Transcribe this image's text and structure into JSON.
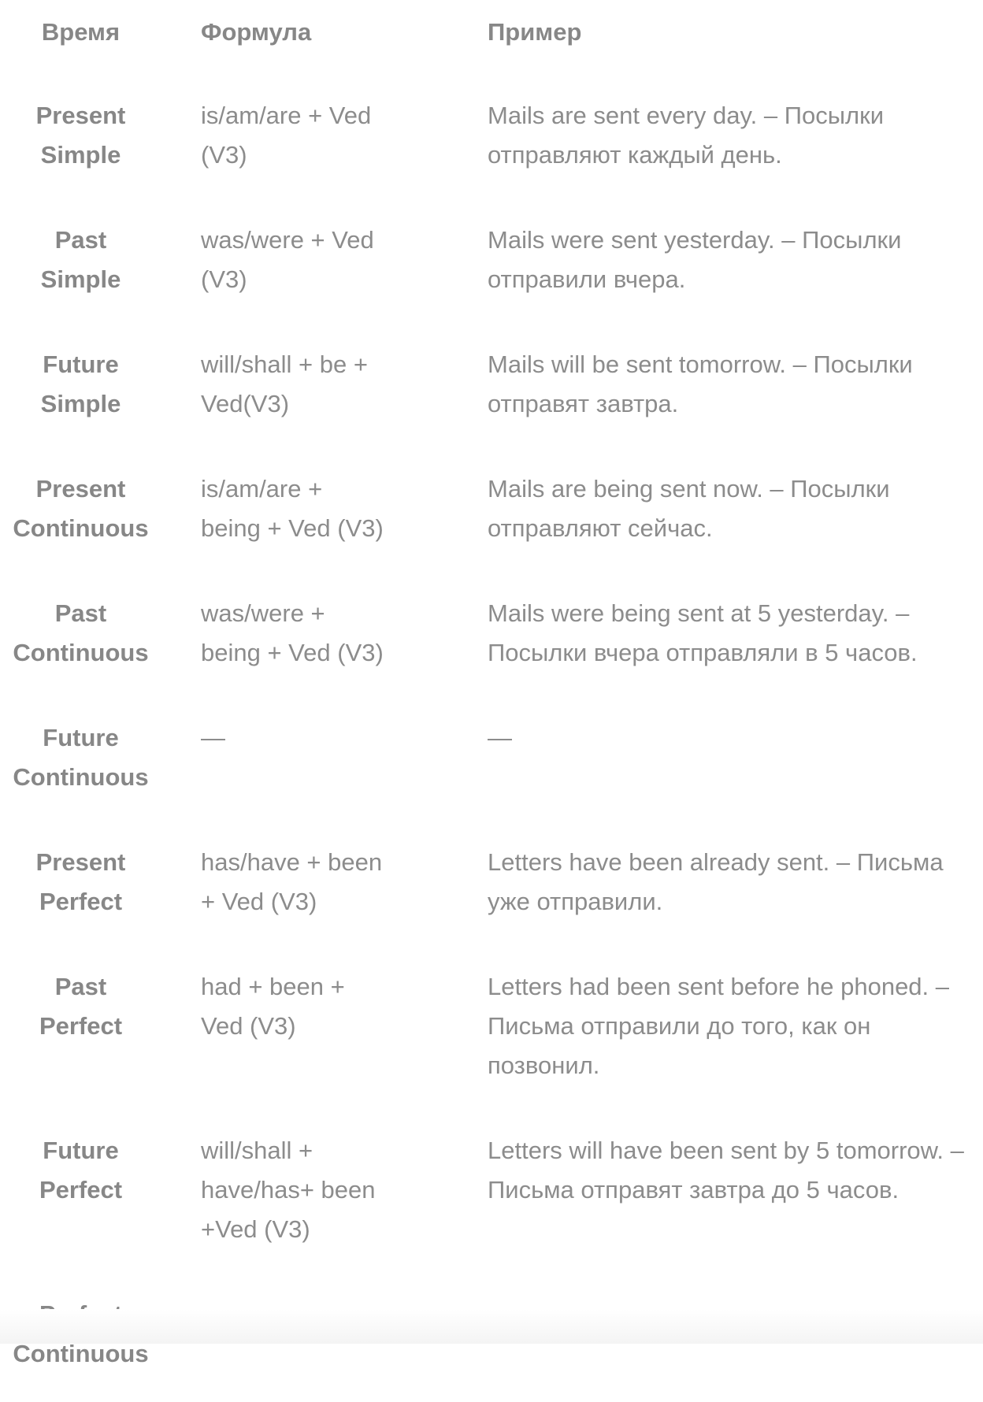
{
  "headers": {
    "tense": "Время",
    "formula": "Формула",
    "example": "Пример"
  },
  "rows": [
    {
      "tense": [
        "Present",
        "Simple"
      ],
      "formula": [
        "is/am/are + Ved",
        "(V3)"
      ],
      "example": [
        "Mails are sent every day. – Посылки",
        "отправляют каждый день."
      ]
    },
    {
      "tense": [
        "Past",
        "Simple"
      ],
      "formula": [
        "was/were + Ved",
        "(V3)"
      ],
      "example": [
        "Mails were sent yesterday. – Посылки",
        "отправили вчера."
      ]
    },
    {
      "tense": [
        "Future",
        "Simple"
      ],
      "formula": [
        "will/shall + be +",
        "Ved(V3)"
      ],
      "example": [
        "Mails will be sent tomorrow. – Посылки",
        "отправят завтра."
      ]
    },
    {
      "tense": [
        "Present",
        "Continuous"
      ],
      "formula": [
        "is/am/are +",
        "being + Ved (V3)"
      ],
      "example": [
        "Mails are being sent now. – Посылки",
        "отправляют сейчас."
      ]
    },
    {
      "tense": [
        "Past",
        "Continuous"
      ],
      "formula": [
        "was/were +",
        "being + Ved (V3)"
      ],
      "example": [
        "Mails were being sent at 5 yesterday. –",
        "Посылки вчера отправляли в 5 часов."
      ]
    },
    {
      "tense": [
        "Future",
        "Continuous"
      ],
      "formula": [
        "—"
      ],
      "example": [
        "—"
      ]
    },
    {
      "tense": [
        "Present",
        "Perfect"
      ],
      "formula": [
        "has/have + been",
        "+ Ved (V3)"
      ],
      "example": [
        "Letters have been already sent. – Письма",
        "уже отправили."
      ]
    },
    {
      "tense": [
        "Past",
        "Perfect"
      ],
      "formula": [
        "had + been +",
        "Ved (V3)"
      ],
      "example": [
        "Letters had been sent before he phoned. –",
        "Письма отправили до того, как он",
        "позвонил."
      ]
    },
    {
      "tense": [
        "Future",
        "Perfect"
      ],
      "formula": [
        "will/shall +",
        "have/has+ been",
        "+Ved (V3)"
      ],
      "example": [
        "Letters will have been sent by 5 tomorrow. –",
        "Письма отправят завтра до 5 часов."
      ]
    },
    {
      "tense": [
        "Perfect",
        "Continuous"
      ],
      "formula": [
        "—"
      ],
      "example": [
        "—"
      ]
    }
  ]
}
